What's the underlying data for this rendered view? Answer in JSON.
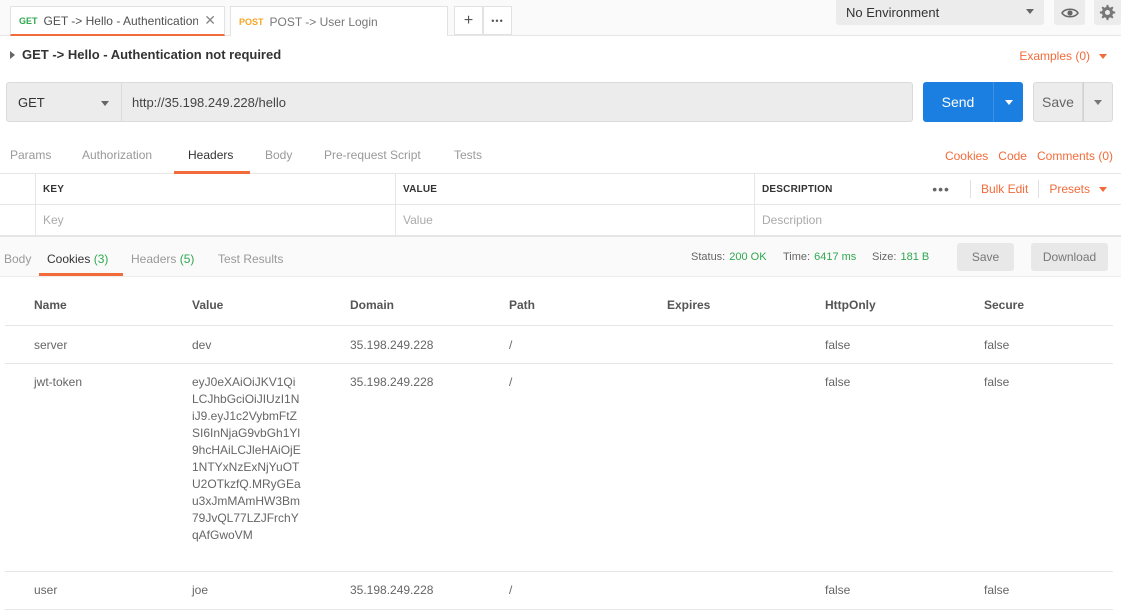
{
  "tabs": [
    {
      "method": "GET",
      "title": "GET -> Hello - Authentication no",
      "close": "✕"
    },
    {
      "method": "POST",
      "title": "POST -> User Login"
    }
  ],
  "tab_buttons": {
    "add": "+",
    "more": "•••"
  },
  "environment": {
    "selected": "No Environment"
  },
  "request": {
    "name": "GET -> Hello - Authentication not required",
    "examples_label": "Examples (0)",
    "method": "GET",
    "url": "http://35.198.249.228/hello",
    "send_label": "Send",
    "save_label": "Save"
  },
  "request_tabs": [
    "Params",
    "Authorization",
    "Headers",
    "Body",
    "Pre-request Script",
    "Tests"
  ],
  "request_links": {
    "cookies": "Cookies",
    "code": "Code",
    "comments": "Comments (0)"
  },
  "headers_table": {
    "columns": [
      "KEY",
      "VALUE",
      "DESCRIPTION"
    ],
    "more": "•••",
    "bulk_edit": "Bulk Edit",
    "presets": "Presets",
    "placeholders": {
      "key": "Key",
      "value": "Value",
      "description": "Description"
    }
  },
  "response_tabs": {
    "body": "Body",
    "cookies": "Cookies",
    "cookies_count": "(3)",
    "headers": "Headers",
    "headers_count": "(5)",
    "test_results": "Test Results"
  },
  "response_meta": {
    "status_label": "Status:",
    "status_value": "200 OK",
    "time_label": "Time:",
    "time_value": "6417 ms",
    "size_label": "Size:",
    "size_value": "181 B",
    "save_label": "Save",
    "download_label": "Download"
  },
  "colors": {
    "accent": "#f26b3a",
    "send": "#1a7fe0",
    "success": "#2fa84f"
  },
  "cookies": {
    "columns": [
      "Name",
      "Value",
      "Domain",
      "Path",
      "Expires",
      "HttpOnly",
      "Secure"
    ],
    "rows": [
      {
        "name": "server",
        "value": "dev",
        "domain": "35.198.249.228",
        "path": "/",
        "expires": "",
        "httponly": "false",
        "secure": "false"
      },
      {
        "name": "jwt-token",
        "value": "eyJ0eXAiOiJKV1QiLCJhbGciOiJIUzI1NiJ9.eyJ1c2VybmFtZSI6InNjaG9vbGh1Yl9hcHAiLCJleHAiOjE1NTYxNzExNjYuOTU2OTkzfQ.MRyGEau3xJmMAmHW3Bm79JvQL77LZJFrchYqAfGwoVM",
        "domain": "35.198.249.228",
        "path": "/",
        "expires": "",
        "httponly": "false",
        "secure": "false"
      },
      {
        "name": "user",
        "value": "joe",
        "domain": "35.198.249.228",
        "path": "/",
        "expires": "",
        "httponly": "false",
        "secure": "false"
      }
    ]
  }
}
